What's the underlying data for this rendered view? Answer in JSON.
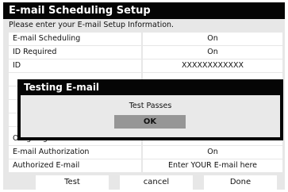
{
  "title": "E-mail Scheduling Setup",
  "instruction": "Please enter your E-mail Setup Information.",
  "rows": [
    {
      "label": "E-mail Scheduling",
      "value": "On"
    },
    {
      "label": "ID Required",
      "value": "On"
    },
    {
      "label": "ID",
      "value": "XXXXXXXXXXXX"
    },
    {
      "label": "",
      "value": ""
    },
    {
      "label": "",
      "value": ""
    },
    {
      "label": "",
      "value": ""
    },
    {
      "label": "",
      "value": ""
    },
    {
      "label": "",
      "value": ""
    },
    {
      "label": "Outgoing Mail Server",
      "value": ""
    },
    {
      "label": "E-mail Authorization",
      "value": "On"
    },
    {
      "label": "Authorized E-mail",
      "value": "Enter YOUR E-mail here"
    }
  ],
  "buttons": {
    "test": "Test",
    "cancel": "cancel",
    "done": "Done"
  },
  "dialog": {
    "title": "Testing E-mail",
    "message": "Test Passes",
    "ok": "OK"
  }
}
